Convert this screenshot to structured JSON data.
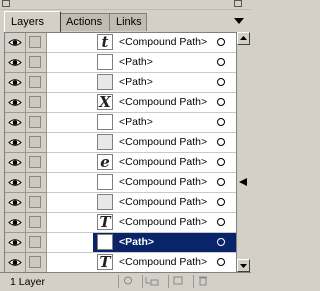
{
  "tabs": [
    {
      "label": "Layers",
      "active": true
    },
    {
      "label": "Actions",
      "active": false
    },
    {
      "label": "Links",
      "active": false
    }
  ],
  "rows": [
    {
      "label": "<Compound Path>",
      "thumb": "t",
      "selected": false
    },
    {
      "label": "<Path>",
      "thumb": "",
      "selected": false
    },
    {
      "label": "<Path>",
      "thumb": "noise",
      "selected": false
    },
    {
      "label": "<Compound Path>",
      "thumb": "X",
      "selected": false
    },
    {
      "label": "<Path>",
      "thumb": "",
      "selected": false
    },
    {
      "label": "<Compound Path>",
      "thumb": "noise",
      "selected": false
    },
    {
      "label": "<Compound Path>",
      "thumb": "e",
      "selected": false
    },
    {
      "label": "<Compound Path>",
      "thumb": "",
      "selected": false
    },
    {
      "label": "<Compound Path>",
      "thumb": "noise",
      "selected": false
    },
    {
      "label": "<Compound Path>",
      "thumb": "T",
      "selected": false
    },
    {
      "label": "<Path>",
      "thumb": "",
      "selected": true
    },
    {
      "label": "<Compound Path>",
      "thumb": "T",
      "selected": false
    }
  ],
  "footer": {
    "layer_count": "1 Layer"
  },
  "colors": {
    "selection": "#0a246a",
    "panel": "#d4d0c8"
  }
}
